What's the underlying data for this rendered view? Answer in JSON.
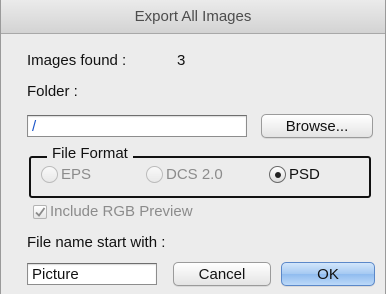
{
  "window": {
    "title": "Export All Images"
  },
  "images_found": {
    "label": "Images found :",
    "count": "3"
  },
  "folder": {
    "label": "Folder :",
    "value": "/",
    "browse_label": "Browse..."
  },
  "file_format": {
    "legend": "File Format",
    "options": [
      {
        "label": "EPS",
        "selected": false,
        "enabled": false
      },
      {
        "label": "DCS 2.0",
        "selected": false,
        "enabled": false
      },
      {
        "label": "PSD",
        "selected": true,
        "enabled": true
      }
    ]
  },
  "rgb_preview": {
    "label": "Include RGB Preview",
    "checked": true,
    "enabled": false
  },
  "file_name": {
    "label": "File name start with :",
    "value": "Picture"
  },
  "buttons": {
    "cancel": "Cancel",
    "ok": "OK"
  },
  "colors": {
    "default_button": "#9cc3f1",
    "folder_text": "#1a55c9"
  }
}
